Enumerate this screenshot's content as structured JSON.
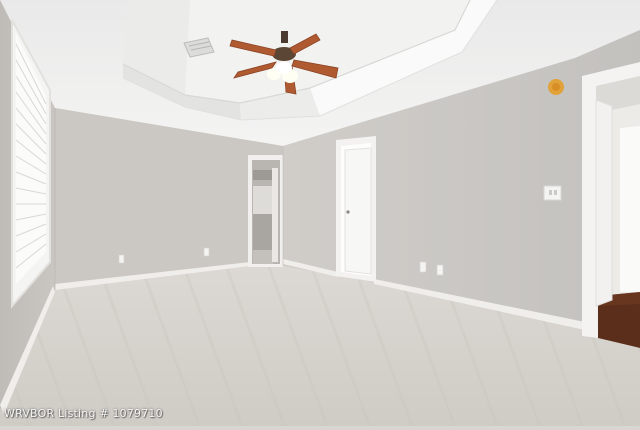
{
  "photo": {
    "watermark": "WRVBOR Listing # 1079710"
  },
  "colors": {
    "wall_left": "#c9c6c1",
    "wall_back": "#cfccc7",
    "wall_right": "#c8c6c3",
    "ceiling": "#eeeeee",
    "carpet": "#d7d4cf",
    "trim": "#f2f1ee",
    "fan_blade": "#b05a32",
    "floor_wood": "#5a2e1a"
  },
  "icons": {
    "ceiling_fan": "ceiling-fan-icon",
    "window_blinds": "window-blinds-icon",
    "smoke_detector": "smoke-detector-icon",
    "light_switch": "light-switch-icon",
    "outlet": "electrical-outlet-icon",
    "air_vent": "air-vent-icon"
  }
}
